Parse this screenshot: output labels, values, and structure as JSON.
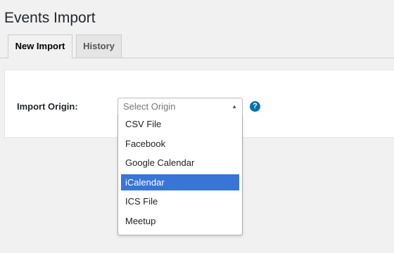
{
  "page": {
    "title": "Events Import"
  },
  "tabs": [
    {
      "label": "New Import",
      "active": true
    },
    {
      "label": "History",
      "active": false
    }
  ],
  "form": {
    "import_origin_label": "Import Origin:",
    "select_placeholder": "Select Origin",
    "help_icon_glyph": "?",
    "options": [
      "CSV File",
      "Facebook",
      "Google Calendar",
      "iCalendar",
      "ICS File",
      "Meetup"
    ],
    "highlighted_option": "iCalendar"
  },
  "colors": {
    "accent": "#0073aa",
    "highlight": "#3875d7",
    "background": "#f1f1f1"
  }
}
